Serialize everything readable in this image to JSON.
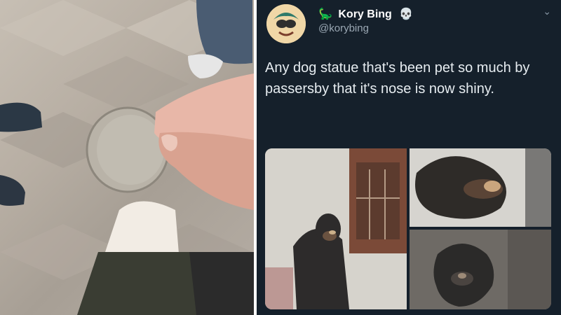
{
  "tweet": {
    "name": "Kory Bing",
    "handle": "@korybing",
    "text": "Any dog statue that's been pet so much by passersby that it's nose is now shiny."
  },
  "icons": {
    "dino": "dinosaur-icon",
    "skull": "skull-icon",
    "chevron": "chevron-down-icon"
  },
  "colors": {
    "tweet_bg": "#15202b",
    "handle": "#9aa7b3",
    "text": "#e6ecf0"
  }
}
